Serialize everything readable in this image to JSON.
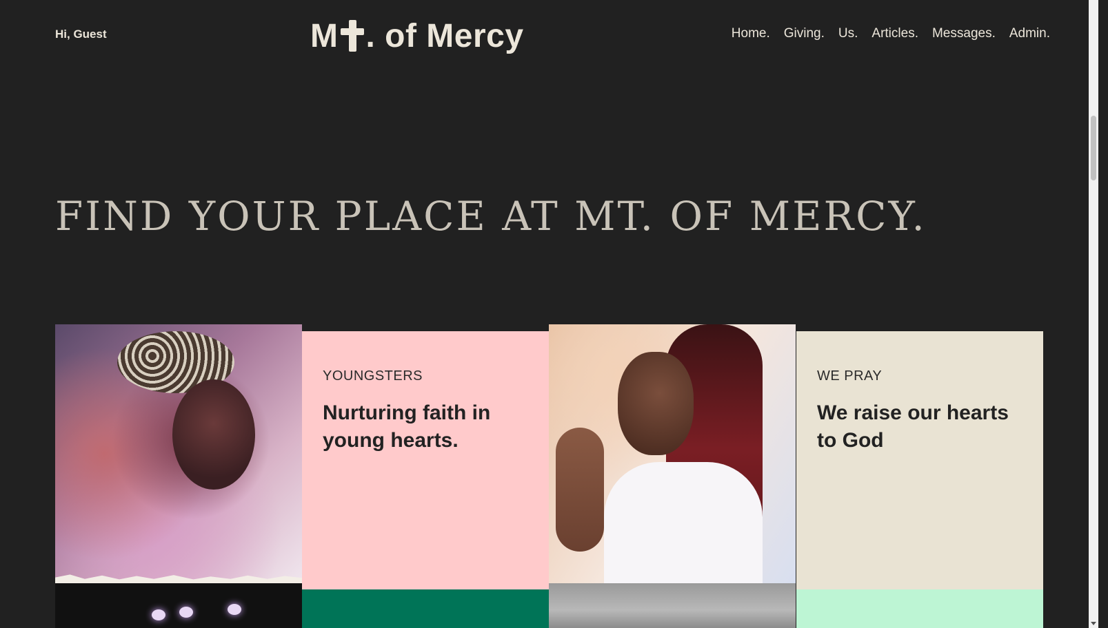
{
  "header": {
    "greeting": "Hi, Guest",
    "logo": {
      "prefix": "M",
      "suffix": ". of Mercy",
      "icon": "cross-icon"
    },
    "nav": [
      {
        "label": "Home."
      },
      {
        "label": "Giving."
      },
      {
        "label": "Us."
      },
      {
        "label": "Articles."
      },
      {
        "label": "Messages."
      },
      {
        "label": "Admin."
      }
    ]
  },
  "hero": {
    "title": "FIND YOUR PLACE AT MT. OF MERCY."
  },
  "cards": [
    {
      "kicker": "YOUNGSTERS",
      "headline": "Nurturing faith in young hearts.",
      "color": "#ffcacb"
    },
    {
      "kicker": "WE PRAY",
      "headline": "We raise our hearts to God",
      "color": "#e9e3d3"
    }
  ],
  "colors": {
    "background": "#212121",
    "text_light": "#ece6da",
    "green_strip": "#007457",
    "mint_strip": "#bdf5d4"
  }
}
